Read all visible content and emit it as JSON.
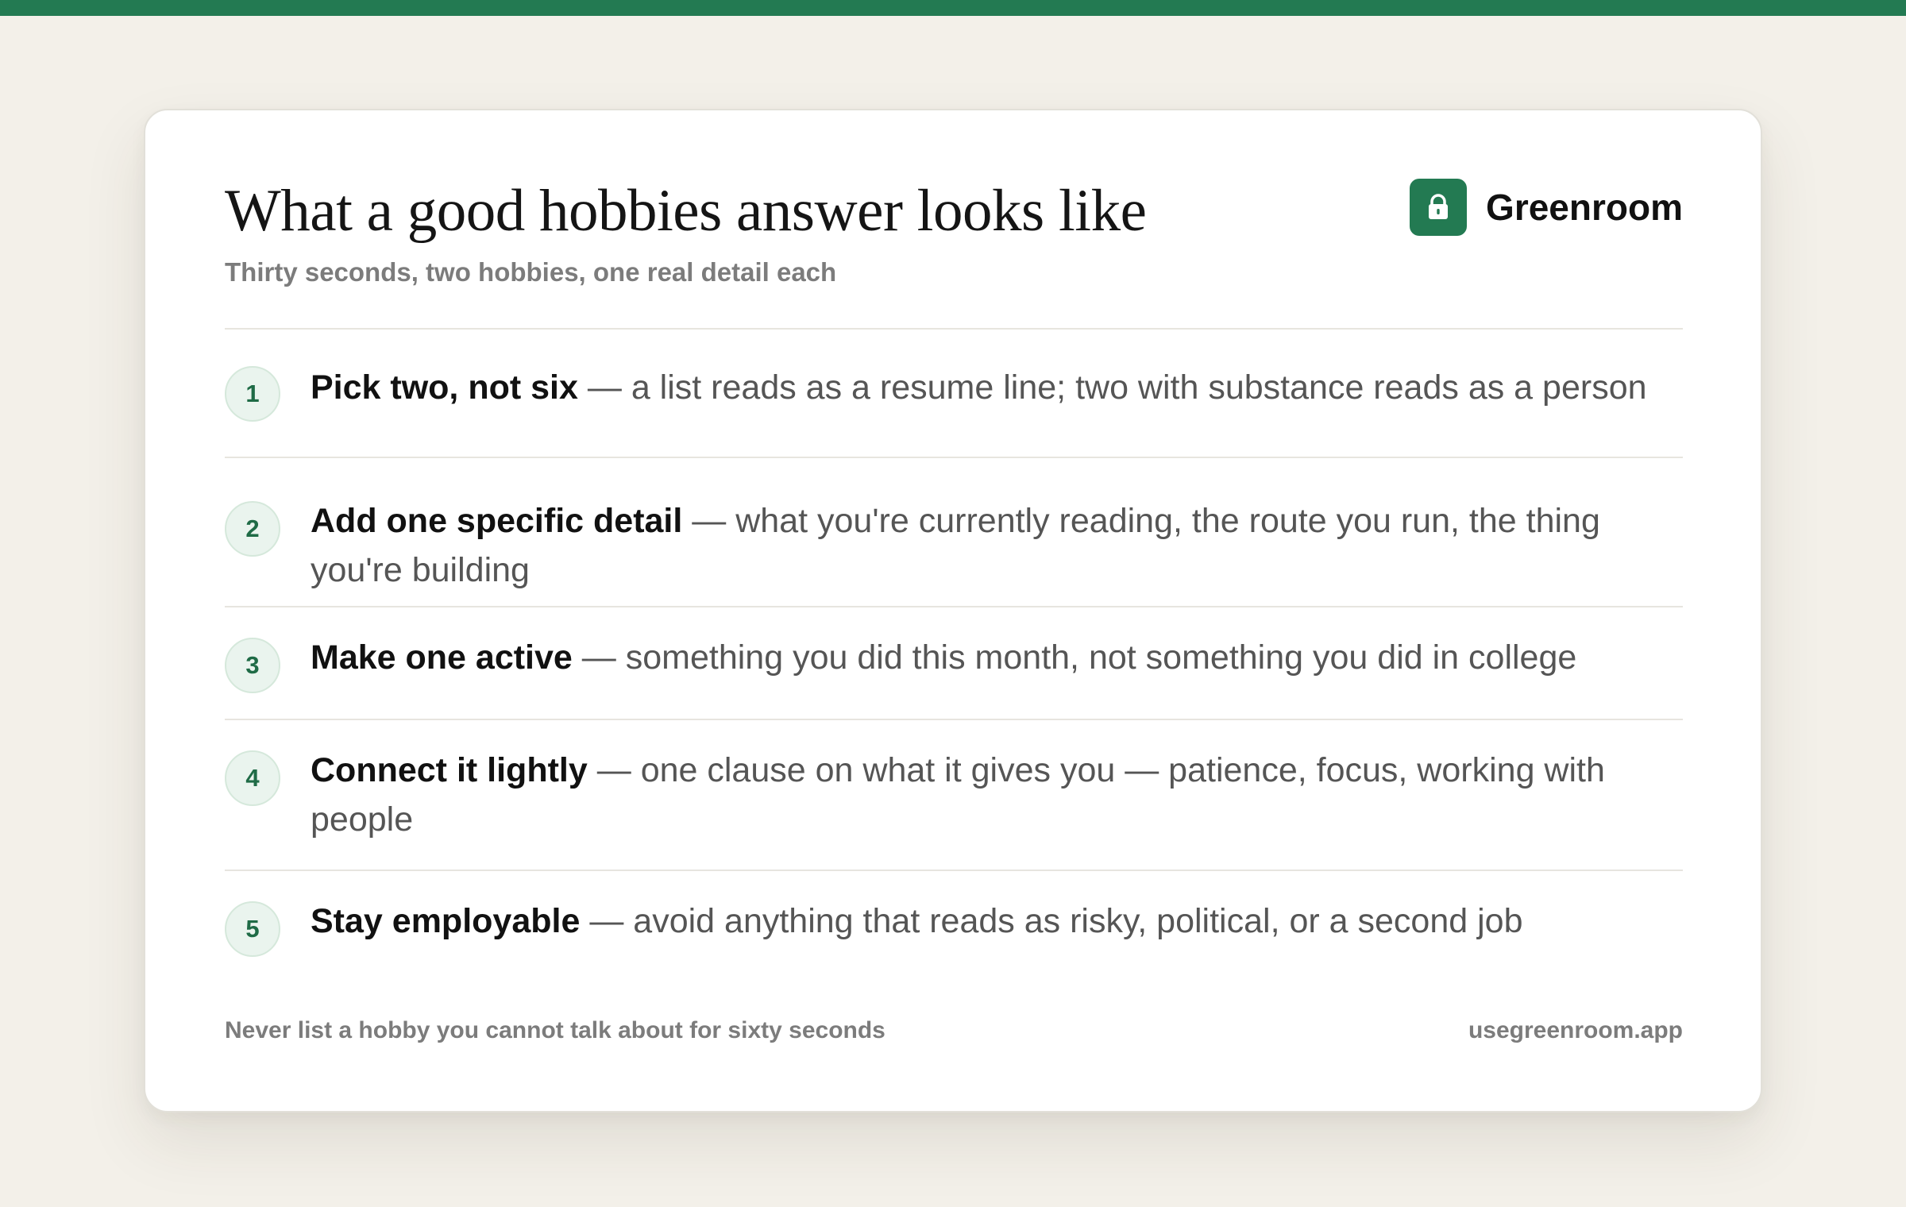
{
  "colors": {
    "accent": "#237a52",
    "background": "#f3f0e9",
    "card": "#ffffff",
    "badge_bg": "#eaf4ee",
    "badge_text": "#1f6b46"
  },
  "header": {
    "title": "What a good hobbies answer looks like",
    "subtitle": "Thirty seconds, two hobbies, one real detail each"
  },
  "brand": {
    "name": "Greenroom",
    "icon": "lock-icon"
  },
  "steps": [
    {
      "number": "1",
      "lead": "Pick two, not six",
      "separator": "—",
      "detail": "a list reads as a resume line; two with substance reads as a person"
    },
    {
      "number": "2",
      "lead": "Add one specific detail",
      "separator": "—",
      "detail": "what you're currently reading, the route you run, the thing you're building"
    },
    {
      "number": "3",
      "lead": "Make one active",
      "separator": "—",
      "detail": "something you did this month, not something you did in college"
    },
    {
      "number": "4",
      "lead": "Connect it lightly",
      "separator": "—",
      "detail": "one clause on what it gives you — patience, focus, working with people"
    },
    {
      "number": "5",
      "lead": "Stay employable",
      "separator": "—",
      "detail": "avoid anything that reads as risky, political, or a second job"
    }
  ],
  "footer": {
    "note": "Never list a hobby you cannot talk about for sixty seconds",
    "url": "usegreenroom.app"
  }
}
